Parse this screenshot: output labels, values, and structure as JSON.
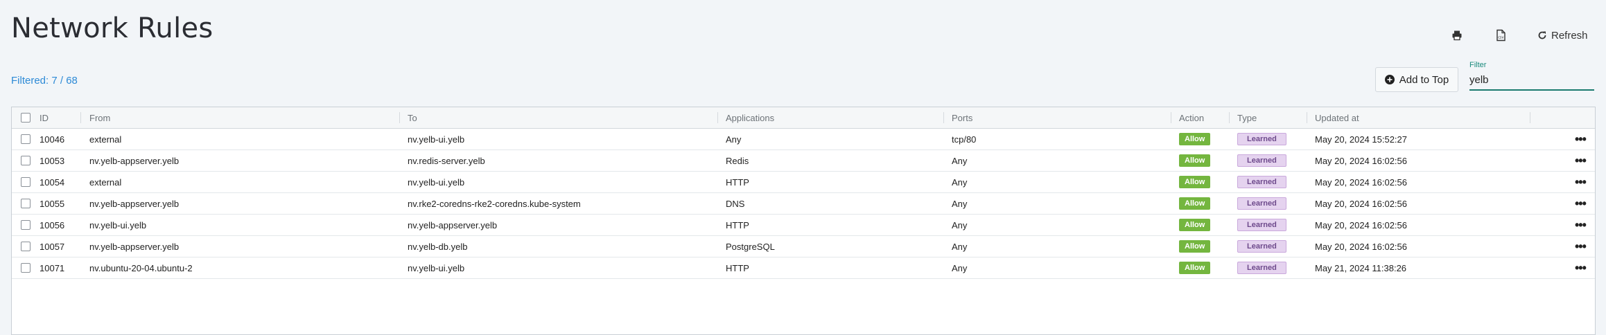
{
  "page": {
    "title": "Network Rules"
  },
  "toolbar": {
    "refresh_label": "Refresh",
    "print_icon": "printer-icon",
    "csv_icon": "csv-icon"
  },
  "summary": {
    "filtered": "Filtered: 7 / 68"
  },
  "actions": {
    "add_to_top": "Add to Top"
  },
  "filter": {
    "label": "Filter",
    "value": "yelb"
  },
  "columns": [
    "ID",
    "From",
    "To",
    "Applications",
    "Ports",
    "Action",
    "Type",
    "Updated at"
  ],
  "rows": [
    {
      "id": "10046",
      "from": "external",
      "to": "nv.yelb-ui.yelb",
      "app": "Any",
      "ports": "tcp/80",
      "action": "Allow",
      "type": "Learned",
      "updated": "May 20, 2024 15:52:27"
    },
    {
      "id": "10053",
      "from": "nv.yelb-appserver.yelb",
      "to": "nv.redis-server.yelb",
      "app": "Redis",
      "ports": "Any",
      "action": "Allow",
      "type": "Learned",
      "updated": "May 20, 2024 16:02:56"
    },
    {
      "id": "10054",
      "from": "external",
      "to": "nv.yelb-ui.yelb",
      "app": "HTTP",
      "ports": "Any",
      "action": "Allow",
      "type": "Learned",
      "updated": "May 20, 2024 16:02:56"
    },
    {
      "id": "10055",
      "from": "nv.yelb-appserver.yelb",
      "to": "nv.rke2-coredns-rke2-coredns.kube-system",
      "app": "DNS",
      "ports": "Any",
      "action": "Allow",
      "type": "Learned",
      "updated": "May 20, 2024 16:02:56"
    },
    {
      "id": "10056",
      "from": "nv.yelb-ui.yelb",
      "to": "nv.yelb-appserver.yelb",
      "app": "HTTP",
      "ports": "Any",
      "action": "Allow",
      "type": "Learned",
      "updated": "May 20, 2024 16:02:56"
    },
    {
      "id": "10057",
      "from": "nv.yelb-appserver.yelb",
      "to": "nv.yelb-db.yelb",
      "app": "PostgreSQL",
      "ports": "Any",
      "action": "Allow",
      "type": "Learned",
      "updated": "May 20, 2024 16:02:56"
    },
    {
      "id": "10071",
      "from": "nv.ubuntu-20-04.ubuntu-2",
      "to": "nv.yelb-ui.yelb",
      "app": "HTTP",
      "ports": "Any",
      "action": "Allow",
      "type": "Learned",
      "updated": "May 21, 2024 11:38:26"
    }
  ],
  "colors": {
    "allow": "#74b63f",
    "learned_bg": "#e5d3ef",
    "accent": "#2d8ad6",
    "filter_accent": "#1a7a6e"
  }
}
